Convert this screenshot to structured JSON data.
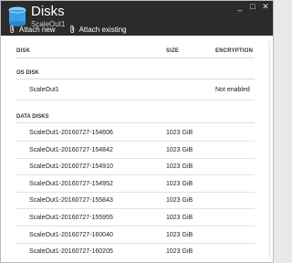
{
  "header": {
    "title": "Disks",
    "subtitle": "ScaleOut1",
    "controls": [
      "_",
      "□",
      "✕"
    ]
  },
  "toolbar": {
    "attach_new": "Attach new",
    "attach_existing": "Attach existing"
  },
  "table": {
    "columns": {
      "disk": "DISK",
      "size": "SIZE",
      "encryption": "ENCRYPTION"
    },
    "os_section": "OS DISK",
    "os_disk": {
      "name": "ScaleOut1",
      "size": "",
      "encryption": "Not enabled"
    },
    "data_section": "DATA DISKS",
    "data_disks": [
      {
        "name": "ScaleOut1-20160727-154606",
        "size": "1023 GiB"
      },
      {
        "name": "ScaleOut1-20160727-154842",
        "size": "1023 GiB"
      },
      {
        "name": "ScaleOut1-20160727-154910",
        "size": "1023 GiB"
      },
      {
        "name": "ScaleOut1-20160727-154952",
        "size": "1023 GiB"
      },
      {
        "name": "ScaleOut1-20160727-155843",
        "size": "1023 GiB"
      },
      {
        "name": "ScaleOut1-20160727-155955",
        "size": "1023 GiB"
      },
      {
        "name": "ScaleOut1-20160727-160040",
        "size": "1023 GiB"
      },
      {
        "name": "ScaleOut1-20160727-160205",
        "size": "1023 GiB"
      }
    ]
  },
  "colors": {
    "header_bg": "#2b2b2b",
    "accent": "#3aa0e8"
  }
}
